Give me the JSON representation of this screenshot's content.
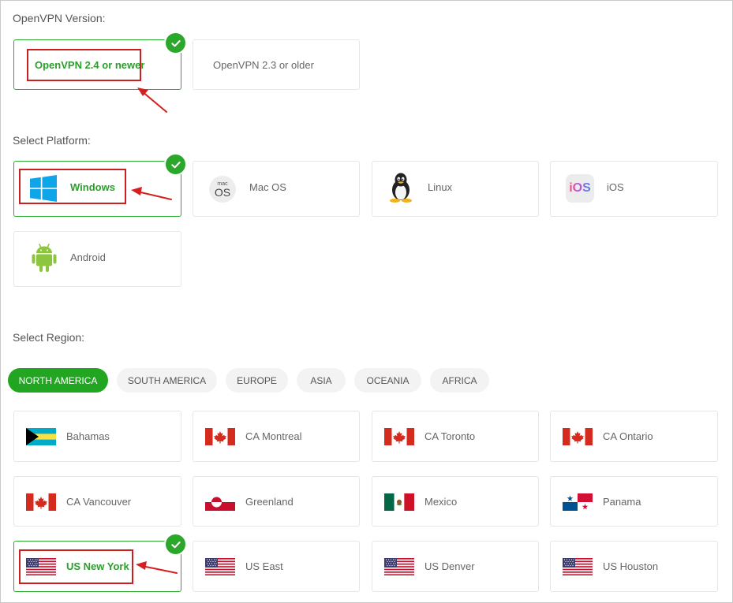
{
  "openvpn": {
    "label": "OpenVPN Version:",
    "options": [
      "OpenVPN 2.4 or newer",
      "OpenVPN 2.3 or older"
    ],
    "selected": "OpenVPN 2.4 or newer"
  },
  "platform": {
    "label": "Select Platform:",
    "items": [
      {
        "label": "Windows",
        "icon": "windows-icon"
      },
      {
        "label": "Mac OS",
        "icon": "macos-icon",
        "icon_text_top": "mac",
        "icon_text_bottom": "OS"
      },
      {
        "label": "Linux",
        "icon": "linux-tux-icon"
      },
      {
        "label": "iOS",
        "icon": "ios-icon",
        "icon_text": "iOS"
      },
      {
        "label": "Android",
        "icon": "android-icon"
      }
    ],
    "selected": "Windows"
  },
  "region": {
    "label": "Select Region:",
    "tabs": [
      "NORTH AMERICA",
      "SOUTH AMERICA",
      "EUROPE",
      "ASIA",
      "OCEANIA",
      "AFRICA"
    ],
    "active_tab": "NORTH AMERICA",
    "servers": [
      {
        "label": "Bahamas",
        "flag": "bahamas-flag-icon"
      },
      {
        "label": "CA Montreal",
        "flag": "canada-flag-icon"
      },
      {
        "label": "CA Toronto",
        "flag": "canada-flag-icon"
      },
      {
        "label": "CA Ontario",
        "flag": "canada-flag-icon"
      },
      {
        "label": "CA Vancouver",
        "flag": "canada-flag-icon"
      },
      {
        "label": "Greenland",
        "flag": "greenland-flag-icon"
      },
      {
        "label": "Mexico",
        "flag": "mexico-flag-icon"
      },
      {
        "label": "Panama",
        "flag": "panama-flag-icon"
      },
      {
        "label": "US New York",
        "flag": "usa-flag-icon"
      },
      {
        "label": "US East",
        "flag": "usa-flag-icon"
      },
      {
        "label": "US Denver",
        "flag": "usa-flag-icon"
      },
      {
        "label": "US Houston",
        "flag": "usa-flag-icon"
      }
    ],
    "selected": "US New York"
  },
  "colors": {
    "accent_green": "#2ba82b",
    "annotation_red": "#cc1f1f",
    "card_border": "#e6e6e6"
  }
}
